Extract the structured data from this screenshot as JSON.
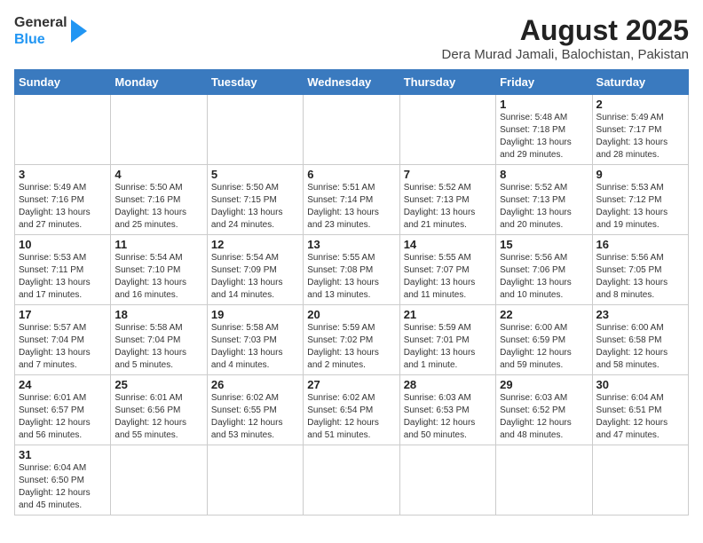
{
  "header": {
    "logo_general": "General",
    "logo_blue": "Blue",
    "title": "August 2025",
    "subtitle": "Dera Murad Jamali, Balochistan, Pakistan"
  },
  "weekdays": [
    "Sunday",
    "Monday",
    "Tuesday",
    "Wednesday",
    "Thursday",
    "Friday",
    "Saturday"
  ],
  "weeks": [
    [
      {
        "day": "",
        "info": ""
      },
      {
        "day": "",
        "info": ""
      },
      {
        "day": "",
        "info": ""
      },
      {
        "day": "",
        "info": ""
      },
      {
        "day": "",
        "info": ""
      },
      {
        "day": "1",
        "info": "Sunrise: 5:48 AM\nSunset: 7:18 PM\nDaylight: 13 hours and 29 minutes."
      },
      {
        "day": "2",
        "info": "Sunrise: 5:49 AM\nSunset: 7:17 PM\nDaylight: 13 hours and 28 minutes."
      }
    ],
    [
      {
        "day": "3",
        "info": "Sunrise: 5:49 AM\nSunset: 7:16 PM\nDaylight: 13 hours and 27 minutes."
      },
      {
        "day": "4",
        "info": "Sunrise: 5:50 AM\nSunset: 7:16 PM\nDaylight: 13 hours and 25 minutes."
      },
      {
        "day": "5",
        "info": "Sunrise: 5:50 AM\nSunset: 7:15 PM\nDaylight: 13 hours and 24 minutes."
      },
      {
        "day": "6",
        "info": "Sunrise: 5:51 AM\nSunset: 7:14 PM\nDaylight: 13 hours and 23 minutes."
      },
      {
        "day": "7",
        "info": "Sunrise: 5:52 AM\nSunset: 7:13 PM\nDaylight: 13 hours and 21 minutes."
      },
      {
        "day": "8",
        "info": "Sunrise: 5:52 AM\nSunset: 7:13 PM\nDaylight: 13 hours and 20 minutes."
      },
      {
        "day": "9",
        "info": "Sunrise: 5:53 AM\nSunset: 7:12 PM\nDaylight: 13 hours and 19 minutes."
      }
    ],
    [
      {
        "day": "10",
        "info": "Sunrise: 5:53 AM\nSunset: 7:11 PM\nDaylight: 13 hours and 17 minutes."
      },
      {
        "day": "11",
        "info": "Sunrise: 5:54 AM\nSunset: 7:10 PM\nDaylight: 13 hours and 16 minutes."
      },
      {
        "day": "12",
        "info": "Sunrise: 5:54 AM\nSunset: 7:09 PM\nDaylight: 13 hours and 14 minutes."
      },
      {
        "day": "13",
        "info": "Sunrise: 5:55 AM\nSunset: 7:08 PM\nDaylight: 13 hours and 13 minutes."
      },
      {
        "day": "14",
        "info": "Sunrise: 5:55 AM\nSunset: 7:07 PM\nDaylight: 13 hours and 11 minutes."
      },
      {
        "day": "15",
        "info": "Sunrise: 5:56 AM\nSunset: 7:06 PM\nDaylight: 13 hours and 10 minutes."
      },
      {
        "day": "16",
        "info": "Sunrise: 5:56 AM\nSunset: 7:05 PM\nDaylight: 13 hours and 8 minutes."
      }
    ],
    [
      {
        "day": "17",
        "info": "Sunrise: 5:57 AM\nSunset: 7:04 PM\nDaylight: 13 hours and 7 minutes."
      },
      {
        "day": "18",
        "info": "Sunrise: 5:58 AM\nSunset: 7:04 PM\nDaylight: 13 hours and 5 minutes."
      },
      {
        "day": "19",
        "info": "Sunrise: 5:58 AM\nSunset: 7:03 PM\nDaylight: 13 hours and 4 minutes."
      },
      {
        "day": "20",
        "info": "Sunrise: 5:59 AM\nSunset: 7:02 PM\nDaylight: 13 hours and 2 minutes."
      },
      {
        "day": "21",
        "info": "Sunrise: 5:59 AM\nSunset: 7:01 PM\nDaylight: 13 hours and 1 minute."
      },
      {
        "day": "22",
        "info": "Sunrise: 6:00 AM\nSunset: 6:59 PM\nDaylight: 12 hours and 59 minutes."
      },
      {
        "day": "23",
        "info": "Sunrise: 6:00 AM\nSunset: 6:58 PM\nDaylight: 12 hours and 58 minutes."
      }
    ],
    [
      {
        "day": "24",
        "info": "Sunrise: 6:01 AM\nSunset: 6:57 PM\nDaylight: 12 hours and 56 minutes."
      },
      {
        "day": "25",
        "info": "Sunrise: 6:01 AM\nSunset: 6:56 PM\nDaylight: 12 hours and 55 minutes."
      },
      {
        "day": "26",
        "info": "Sunrise: 6:02 AM\nSunset: 6:55 PM\nDaylight: 12 hours and 53 minutes."
      },
      {
        "day": "27",
        "info": "Sunrise: 6:02 AM\nSunset: 6:54 PM\nDaylight: 12 hours and 51 minutes."
      },
      {
        "day": "28",
        "info": "Sunrise: 6:03 AM\nSunset: 6:53 PM\nDaylight: 12 hours and 50 minutes."
      },
      {
        "day": "29",
        "info": "Sunrise: 6:03 AM\nSunset: 6:52 PM\nDaylight: 12 hours and 48 minutes."
      },
      {
        "day": "30",
        "info": "Sunrise: 6:04 AM\nSunset: 6:51 PM\nDaylight: 12 hours and 47 minutes."
      }
    ],
    [
      {
        "day": "31",
        "info": "Sunrise: 6:04 AM\nSunset: 6:50 PM\nDaylight: 12 hours and 45 minutes."
      },
      {
        "day": "",
        "info": ""
      },
      {
        "day": "",
        "info": ""
      },
      {
        "day": "",
        "info": ""
      },
      {
        "day": "",
        "info": ""
      },
      {
        "day": "",
        "info": ""
      },
      {
        "day": "",
        "info": ""
      }
    ]
  ]
}
